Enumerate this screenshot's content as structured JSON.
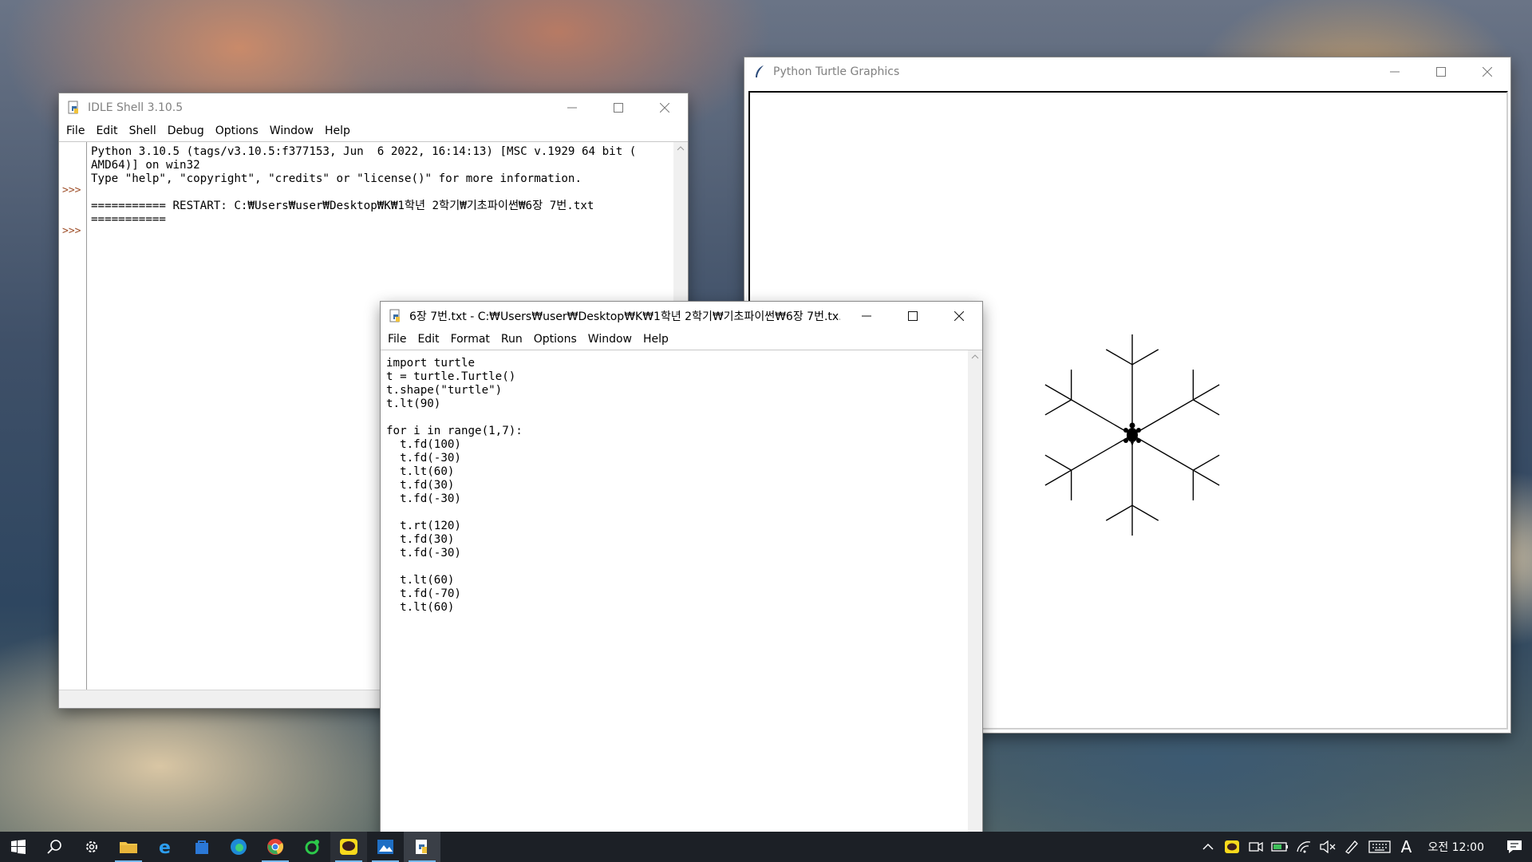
{
  "idle_shell": {
    "title": "IDLE Shell 3.10.5",
    "menu": [
      "File",
      "Edit",
      "Shell",
      "Debug",
      "Options",
      "Window",
      "Help"
    ],
    "prompts": [
      ">>>",
      ">>>"
    ],
    "lines": [
      "Python 3.10.5 (tags/v3.10.5:f377153, Jun  6 2022, 16:14:13) [MSC v.1929 64 bit (",
      "AMD64)] on win32",
      "Type \"help\", \"copyright\", \"credits\" or \"license()\" for more information.",
      "",
      "=========== RESTART: C:₩Users₩user₩Desktop₩K₩1학년 2학기₩기초파이썬₩6장 7번.txt",
      "==========="
    ]
  },
  "turtle_window": {
    "title": "Python Turtle Graphics",
    "drawing": {
      "type": "snowflake",
      "arms": 6,
      "arm_length": 100,
      "branch_length": 30,
      "branch_angle": 60,
      "turtle_shape": "turtle",
      "pen_color": "#000000"
    }
  },
  "editor": {
    "title": "6장 7번.txt - C:₩Users₩user₩Desktop₩K₩1학년 2학기₩기초파이썬₩6장 7번.tx...",
    "menu": [
      "File",
      "Edit",
      "Format",
      "Run",
      "Options",
      "Window",
      "Help"
    ],
    "lines": [
      "import turtle",
      "t = turtle.Turtle()",
      "t.shape(\"turtle\")",
      "t.lt(90)",
      "",
      "for i in range(1,7):",
      "  t.fd(100)",
      "  t.fd(-30)",
      "  t.lt(60)",
      "  t.fd(30)",
      "  t.fd(-30)",
      "",
      "  t.rt(120)",
      "  t.fd(30)",
      "  t.fd(-30)",
      "",
      "  t.lt(60)",
      "  t.fd(-70)",
      "  t.lt(60)"
    ]
  },
  "taskbar": {
    "apps": [
      "start-icon",
      "search-icon",
      "settings-icon",
      "file-explorer-icon",
      "internet-explorer-icon",
      "store-icon",
      "edge-icon",
      "chrome-icon",
      "line-app-icon",
      "kakaotalk-icon",
      "photos-icon",
      "idle-icon"
    ],
    "tray": {
      "ime_mode": "A",
      "clock": "오전 12:00"
    }
  },
  "colors": {
    "taskbar": "#1c2026",
    "prompt": "#a0522d",
    "accent": "#76b9ed"
  }
}
